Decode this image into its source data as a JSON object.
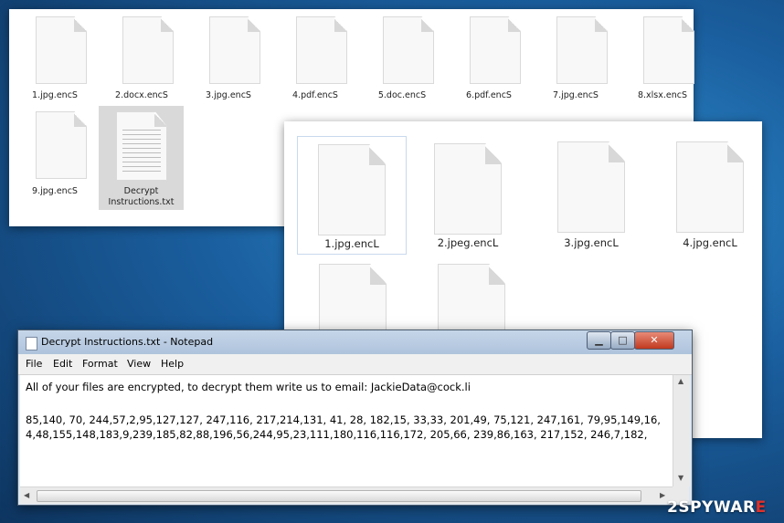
{
  "explorer_small": {
    "files": [
      {
        "name": "1.jpg.encS"
      },
      {
        "name": "2.docx.encS"
      },
      {
        "name": "3.jpg.encS"
      },
      {
        "name": "4.pdf.encS"
      },
      {
        "name": "5.doc.encS"
      },
      {
        "name": "6.pdf.encS"
      },
      {
        "name": "7.jpg.encS"
      },
      {
        "name": "8.xlsx.encS"
      },
      {
        "name": "9.jpg.encS"
      },
      {
        "name": "Decrypt Instructions.txt"
      }
    ]
  },
  "explorer_large": {
    "files": [
      {
        "name": "1.jpg.encL"
      },
      {
        "name": "2.jpeg.encL"
      },
      {
        "name": "3.jpg.encL"
      },
      {
        "name": "4.jpg.encL"
      },
      {
        "name": ""
      },
      {
        "name": ""
      }
    ]
  },
  "notepad": {
    "title": "Decrypt Instructions.txt - Notepad",
    "menu": [
      "File",
      "Edit",
      "Format",
      "View",
      "Help"
    ],
    "lines": [
      "All of your files are encrypted, to decrypt them write us to email: JackieData@cock.li",
      "",
      "85,140, 70, 244,57,2,95,127,127, 247,116, 217,214,131, 41, 28, 182,15, 33,33, 201,49, 75,121, 247,161, 79,95,149,16,",
      "4,48,155,148,183,9,239,185,82,88,196,56,244,95,23,111,180,116,116,172, 205,66, 239,86,163, 217,152, 246,7,182,"
    ],
    "buttons": {
      "minimize": "▁",
      "maximize": "□",
      "close": "✕"
    }
  },
  "watermark": {
    "part1": "2",
    "part2": "SPYWAR",
    "part3": "E"
  },
  "colors": {
    "desktop": "#1a5e9e",
    "close_button": "#c0391f",
    "watermark_accent": "#e0302a"
  }
}
